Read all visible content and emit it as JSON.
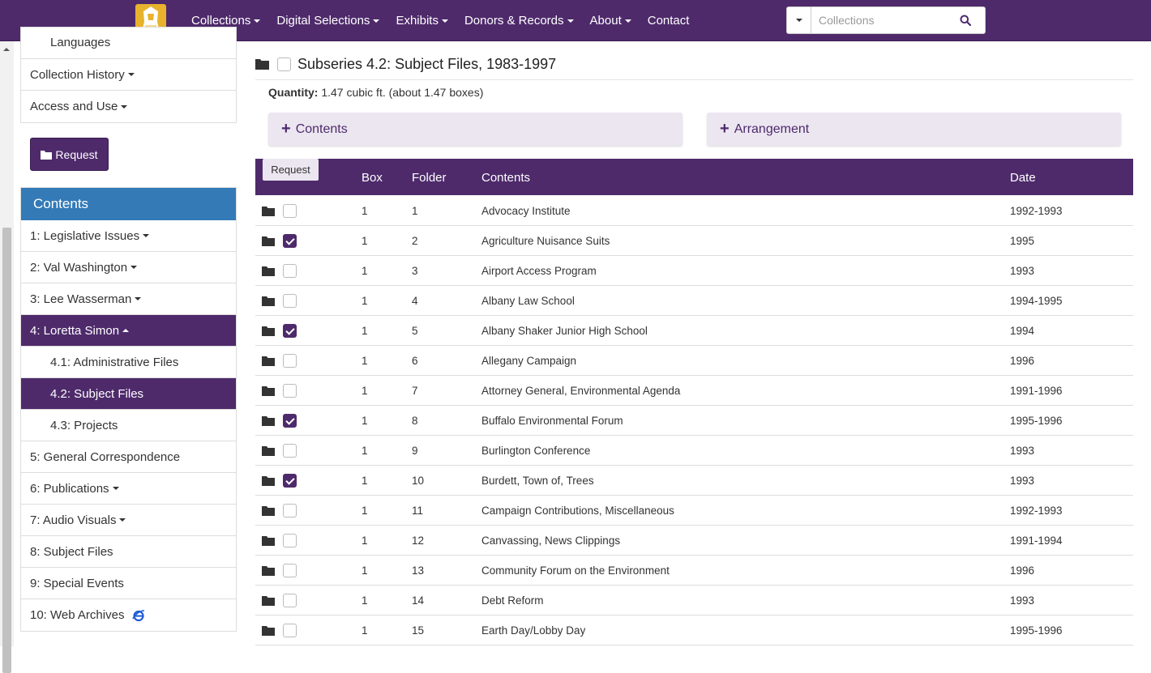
{
  "navbar": {
    "items": [
      {
        "label": "Collections",
        "dropdown": true
      },
      {
        "label": "Digital Selections",
        "dropdown": true
      },
      {
        "label": "Exhibits",
        "dropdown": true
      },
      {
        "label": "Donors & Records",
        "dropdown": true
      },
      {
        "label": "About",
        "dropdown": true
      },
      {
        "label": "Contact",
        "dropdown": false
      }
    ],
    "search": {
      "placeholder": "Collections"
    },
    "brand_color": "#4e2a6b"
  },
  "sidebar": {
    "top_items": [
      {
        "label": "Languages",
        "dropdown": false
      },
      {
        "label": "Collection History",
        "dropdown": true
      },
      {
        "label": "Access and Use",
        "dropdown": true
      }
    ],
    "request_label": "Request",
    "contents_header": "Contents",
    "contents_items": [
      {
        "label": "1: Legislative Issues",
        "dropdown": true
      },
      {
        "label": "2: Val Washington",
        "dropdown": true
      },
      {
        "label": "3: Lee Wasserman",
        "dropdown": true
      },
      {
        "label": "4: Loretta Simon",
        "expanded": true,
        "active": true
      },
      {
        "label": "4.1: Administrative Files",
        "sub": true
      },
      {
        "label": "4.2: Subject Files",
        "sub": true,
        "active": true
      },
      {
        "label": "4.3: Projects",
        "sub": true
      },
      {
        "label": "5: General Correspondence"
      },
      {
        "label": "6: Publications",
        "dropdown": true
      },
      {
        "label": "7: Audio Visuals",
        "dropdown": true
      },
      {
        "label": "8: Subject Files"
      },
      {
        "label": "9: Special Events"
      },
      {
        "label": "10: Web Archives",
        "icon": "ie-browser-icon"
      }
    ]
  },
  "main": {
    "title": "Subseries 4.2: Subject Files, 1983-1997",
    "quantity_label": "Quantity:",
    "quantity_value": " 1.47 cubic ft. (about 1.47 boxes)",
    "panels": {
      "contents": "Contents",
      "arrangement": "Arrangement"
    },
    "table": {
      "request_label": "Request",
      "headers": {
        "box": "Box",
        "folder": "Folder",
        "contents": "Contents",
        "date": "Date"
      },
      "rows": [
        {
          "checked": false,
          "box": "1",
          "folder": "1",
          "contents": "Advocacy Institute",
          "date": "1992-1993"
        },
        {
          "checked": true,
          "box": "1",
          "folder": "2",
          "contents": "Agriculture Nuisance Suits",
          "date": "1995"
        },
        {
          "checked": false,
          "box": "1",
          "folder": "3",
          "contents": "Airport Access Program",
          "date": "1993"
        },
        {
          "checked": false,
          "box": "1",
          "folder": "4",
          "contents": "Albany Law School",
          "date": "1994-1995"
        },
        {
          "checked": true,
          "box": "1",
          "folder": "5",
          "contents": "Albany Shaker Junior High School",
          "date": "1994"
        },
        {
          "checked": false,
          "box": "1",
          "folder": "6",
          "contents": "Allegany Campaign",
          "date": "1996"
        },
        {
          "checked": false,
          "box": "1",
          "folder": "7",
          "contents": "Attorney General, Environmental Agenda",
          "date": "1991-1996"
        },
        {
          "checked": true,
          "box": "1",
          "folder": "8",
          "contents": "Buffalo Environmental Forum",
          "date": "1995-1996"
        },
        {
          "checked": false,
          "box": "1",
          "folder": "9",
          "contents": "Burlington Conference",
          "date": "1993"
        },
        {
          "checked": true,
          "box": "1",
          "folder": "10",
          "contents": "Burdett, Town of, Trees",
          "date": "1993"
        },
        {
          "checked": false,
          "box": "1",
          "folder": "11",
          "contents": "Campaign Contributions, Miscellaneous",
          "date": "1992-1993"
        },
        {
          "checked": false,
          "box": "1",
          "folder": "12",
          "contents": "Canvassing, News Clippings",
          "date": "1991-1994"
        },
        {
          "checked": false,
          "box": "1",
          "folder": "13",
          "contents": "Community Forum on the Environment",
          "date": "1996"
        },
        {
          "checked": false,
          "box": "1",
          "folder": "14",
          "contents": "Debt Reform",
          "date": "1993"
        },
        {
          "checked": false,
          "box": "1",
          "folder": "15",
          "contents": "Earth Day/Lobby Day",
          "date": "1995-1996"
        }
      ]
    }
  }
}
